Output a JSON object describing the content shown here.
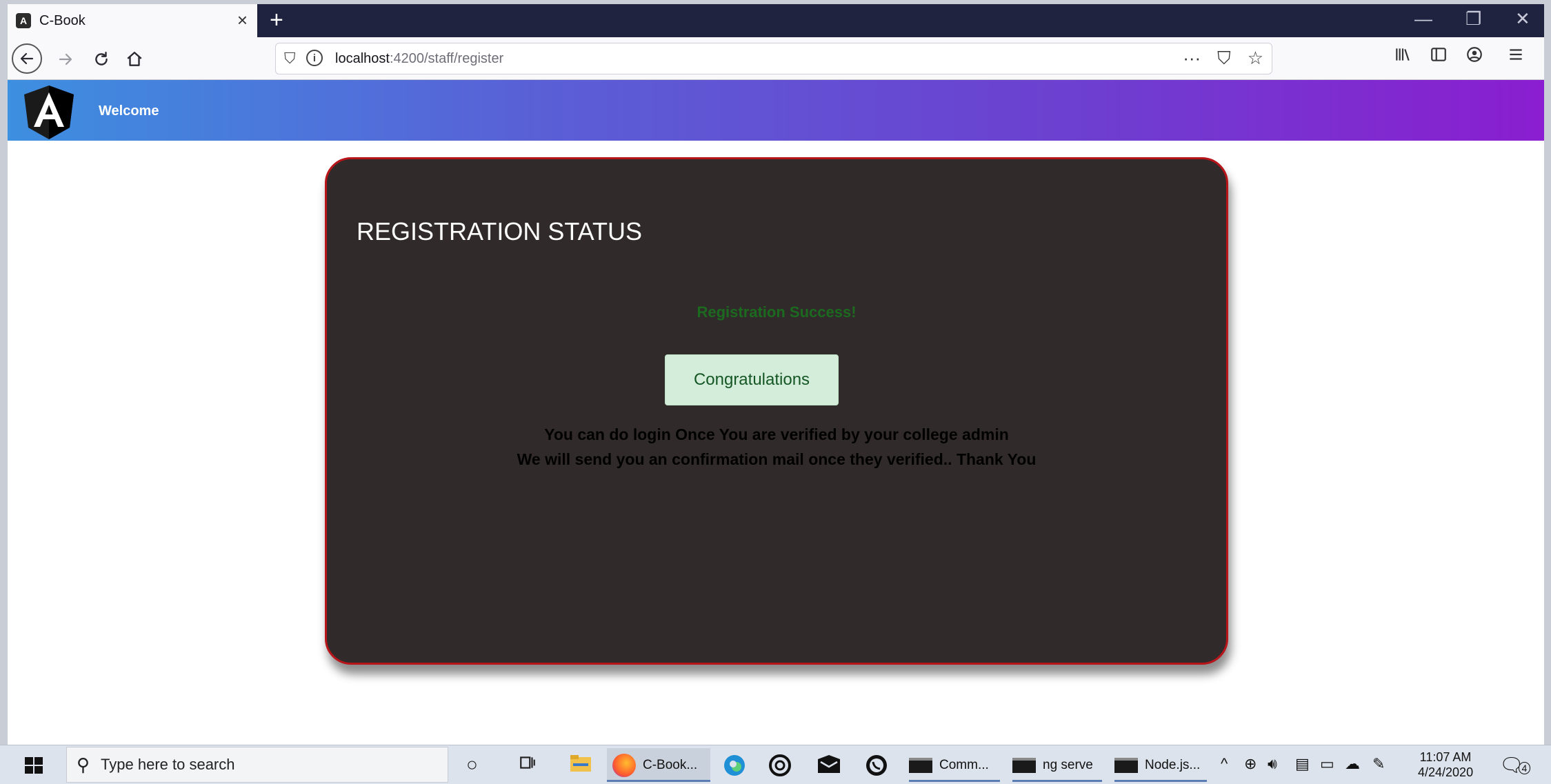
{
  "browser": {
    "tab_title": "C-Book",
    "tab_favicon": "A",
    "tab_close": "×",
    "new_tab": "+",
    "window_controls": [
      "—",
      "❐",
      "✕"
    ],
    "url_host": "localhost",
    "url_rest": ":4200/staff/register",
    "page_actions": [
      "···",
      "⛉",
      "☆"
    ],
    "toolbar_icons": [
      "library-icon",
      "sidebar-icon",
      "account-icon",
      "menu-icon"
    ]
  },
  "app": {
    "header_title": "Welcome",
    "logo_letter": "A",
    "brand_gradient": [
      "#3d8fe0",
      "#8a1ed0"
    ]
  },
  "registration": {
    "title": "REGISTRATION STATUS",
    "success_message": "Registration Success!",
    "button_label": "Congratulations",
    "message_line1": "You can do login Once You are verified by your college admin",
    "message_line2": "We will send you an confirmation mail once they verified.. Thank You",
    "card_bg": "#312a2a",
    "card_border": "#b8151b",
    "success_color": "#1b6a1f"
  },
  "taskbar": {
    "search_placeholder": "Type here to search",
    "apps": [
      {
        "label": "C-Book...",
        "icon": "firefox-icon"
      },
      {
        "label": "Comm...",
        "icon": "terminal-icon"
      },
      {
        "label": "ng serve",
        "icon": "terminal-icon"
      },
      {
        "label": "Node.js...",
        "icon": "terminal-icon"
      }
    ],
    "time": "11:07 AM",
    "date": "4/24/2020",
    "notification_count": "4"
  }
}
